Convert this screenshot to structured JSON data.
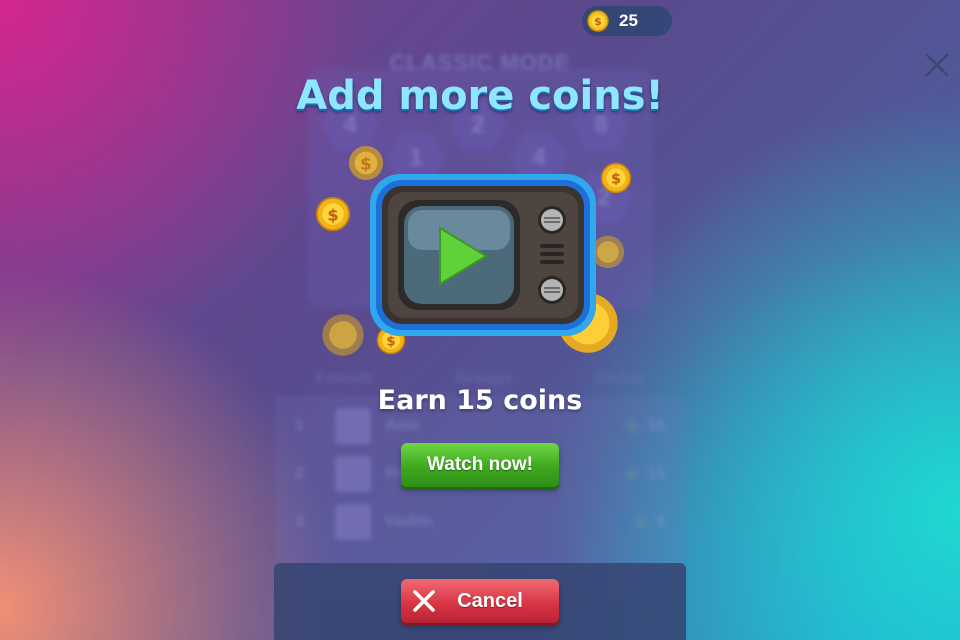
{
  "hud": {
    "coins": "25"
  },
  "background": {
    "mode_title": "CLASSIC MODE",
    "hex_values": [
      "4",
      "2",
      "8",
      "1",
      "4",
      "2"
    ],
    "tabs": [
      "Friends",
      "Groups",
      "Global"
    ],
    "leaderboard": [
      {
        "rank": "1",
        "name": "Anie",
        "score": "16"
      },
      {
        "rank": "2",
        "name": "Ro",
        "score": "15"
      },
      {
        "rank": "3",
        "name": "Vadim",
        "score": "8"
      }
    ]
  },
  "dialog": {
    "headline": "Add more coins!",
    "reward_text": "Earn 15 coins",
    "watch_button": "Watch now!",
    "cancel_button": "Cancel"
  },
  "icons": {
    "coin": "dollar-coin-icon",
    "close": "close-icon",
    "tv": "tv-play-icon",
    "cancel": "x-icon",
    "star": "star-icon"
  },
  "colors": {
    "headline": "#8fe6ff",
    "watch_button": "#3ea81f",
    "cancel_button": "#d93645",
    "coin": "#f5c21b"
  }
}
